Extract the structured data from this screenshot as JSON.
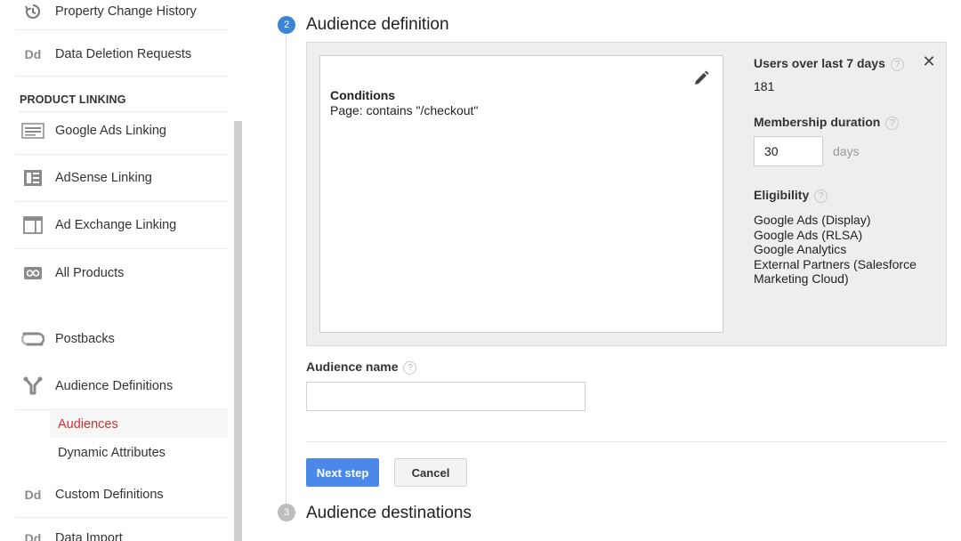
{
  "sidebar": {
    "items_top": [
      {
        "label": "Property Change History",
        "icon": "history-icon"
      },
      {
        "label": "Data Deletion Requests",
        "icon": "dd-icon"
      }
    ],
    "section_header": "PRODUCT LINKING",
    "linking_items": [
      {
        "label": "Google Ads Linking",
        "icon": "google-ads-icon"
      },
      {
        "label": "AdSense Linking",
        "icon": "adsense-icon"
      },
      {
        "label": "Ad Exchange Linking",
        "icon": "ad-exchange-icon"
      },
      {
        "label": "All Products",
        "icon": "all-products-icon"
      }
    ],
    "postbacks": "Postbacks",
    "audience_definitions": "Audience Definitions",
    "sub_items": [
      {
        "label": "Audiences",
        "active": true
      },
      {
        "label": "Dynamic Attributes",
        "active": false
      }
    ],
    "custom_definitions": "Custom Definitions",
    "data_import": "Data Import",
    "dd_glyph": "Dd"
  },
  "steps": {
    "step2": {
      "number": "2",
      "title": "Audience definition"
    },
    "step3": {
      "number": "3",
      "title": "Audience destinations"
    }
  },
  "definition": {
    "conditions_title": "Conditions",
    "conditions_text": "Page: contains \"/checkout\"",
    "users_label": "Users over last 7 days",
    "users_value": "181",
    "membership_label": "Membership duration",
    "membership_value": "30",
    "membership_unit": "days",
    "eligibility_label": "Eligibility",
    "eligibility": [
      "Google Ads (Display)",
      "Google Ads (RLSA)",
      "Google Analytics",
      "External Partners (Salesforce Marketing Cloud)"
    ],
    "help_glyph": "?",
    "close_glyph": "✕"
  },
  "form": {
    "name_label": "Audience name",
    "name_value": "",
    "next_label": "Next step",
    "cancel_label": "Cancel"
  },
  "colors": {
    "accent_blue": "#4a89e8",
    "step_active": "#3b85d6",
    "step_inactive": "#bdbdbd",
    "active_link": "#d03030"
  }
}
